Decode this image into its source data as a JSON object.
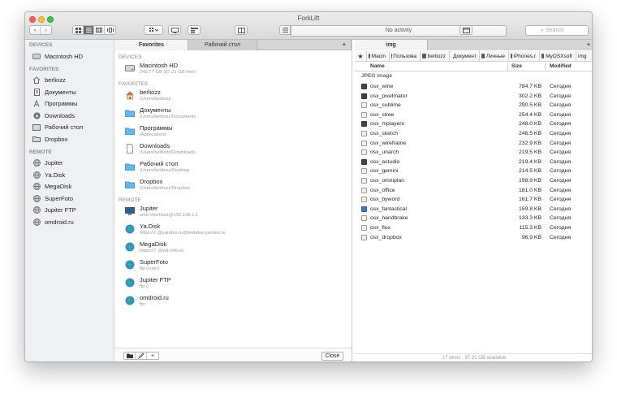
{
  "window": {
    "title": "ForkLift"
  },
  "toolbar": {
    "back": "‹",
    "forward": "›",
    "activity": "No activity",
    "search_placeholder": "Search"
  },
  "sidebar": {
    "sections": [
      {
        "title": "DEVICES",
        "items": [
          {
            "label": "Macintosh HD",
            "icon": "hard-drive-icon"
          }
        ]
      },
      {
        "title": "FAVORITES",
        "items": [
          {
            "label": "berliozz",
            "icon": "home-icon"
          },
          {
            "label": "Документы",
            "icon": "documents-icon"
          },
          {
            "label": "Программы",
            "icon": "applications-icon"
          },
          {
            "label": "Downloads",
            "icon": "downloads-icon"
          },
          {
            "label": "Рабочий стол",
            "icon": "desktop-icon"
          },
          {
            "label": "Dropbox",
            "icon": "dropbox-icon"
          }
        ]
      },
      {
        "title": "REMOTE",
        "items": [
          {
            "label": "Jupiter",
            "icon": "globe-icon"
          },
          {
            "label": "Ya.Disk",
            "icon": "globe-icon"
          },
          {
            "label": "MegaDisk",
            "icon": "globe-icon"
          },
          {
            "label": "SuperFoto",
            "icon": "globe-icon"
          },
          {
            "label": "Jupiter FTP",
            "icon": "globe-icon"
          },
          {
            "label": "omdroid.ru",
            "icon": "globe-icon"
          }
        ]
      }
    ]
  },
  "left_panel": {
    "tabs": [
      "Favorites",
      "Рабочий стол"
    ],
    "add_tab": "+",
    "sections": [
      {
        "title": "DEVICES",
        "items": [
          {
            "name": "Macintosh HD",
            "detail": "249.77 GB (97.21 GB free)",
            "icon": "hard-drive-icon"
          }
        ]
      },
      {
        "title": "FAVORITES",
        "items": [
          {
            "name": "berliozz",
            "detail": "/Users/berliozz",
            "icon": "home-icon"
          },
          {
            "name": "Документы",
            "detail": "/Users/berliozz/Documents",
            "icon": "folder-icon"
          },
          {
            "name": "Программы",
            "detail": "/Applications",
            "icon": "folder-icon"
          },
          {
            "name": "Downloads",
            "detail": "/Users/berliozz/Downloads",
            "icon": "document-icon"
          },
          {
            "name": "Рабочий стол",
            "detail": "/Users/berliozz/Desktop",
            "icon": "folder-icon"
          },
          {
            "name": "Dropbox",
            "detail": "/Users/berliozz/Dropbox",
            "icon": "folder-icon"
          }
        ]
      },
      {
        "title": "REMOTE",
        "items": [
          {
            "name": "Jupiter",
            "detail": "smb://berliozz@192.168.1.1",
            "icon": "monitor-icon"
          },
          {
            "name": "Ya.Disk",
            "detail": "https://c                  @yandex.ru@webdav.yandex.ru",
            "icon": "globe-icon"
          },
          {
            "name": "MegaDisk",
            "detail": "https://7                  @wd.mfd.sk",
            "icon": "globe-icon"
          },
          {
            "name": "SuperFoto",
            "detail": "ftp://user(",
            "icon": "globe-icon"
          },
          {
            "name": "Jupiter FTP",
            "detail": "ftp://",
            "icon": "globe-icon"
          },
          {
            "name": "omdroid.ru",
            "detail": "ftp",
            "icon": "globe-icon"
          }
        ]
      }
    ],
    "close_label": "Close"
  },
  "right_panel": {
    "tab": "img",
    "add_tab": "+",
    "breadcrumb": [
      "Macin",
      "Пользова",
      "berliozz",
      "Документ",
      "Личные",
      "iPhones,r",
      "MyOSXsoft",
      "img"
    ],
    "columns": {
      "name": "Name",
      "size": "Size",
      "modified": "Modified"
    },
    "group": "JPEG image",
    "files": [
      {
        "name": "osx_wine",
        "size": "784.7 KB",
        "modified": "Сегодня",
        "icon": "image-file-icon"
      },
      {
        "name": "osx_pixelmator",
        "size": "302.2 KB",
        "modified": "Сегодня",
        "icon": "image-file-icon"
      },
      {
        "name": "osx_sublime",
        "size": "290.5 KB",
        "modified": "Сегодня",
        "icon": "image-file-icon"
      },
      {
        "name": "osx_stree",
        "size": "254.4 KB",
        "modified": "Сегодня",
        "icon": "image-file-icon"
      },
      {
        "name": "osx_mplayerx",
        "size": "248.0 KB",
        "modified": "Сегодня",
        "icon": "image-file-icon"
      },
      {
        "name": "osx_sketch",
        "size": "246.5 KB",
        "modified": "Сегодня",
        "icon": "image-file-icon"
      },
      {
        "name": "osx_wireframe",
        "size": "232.9 KB",
        "modified": "Сегодня",
        "icon": "image-file-icon"
      },
      {
        "name": "osx_unarch",
        "size": "219.5 KB",
        "modified": "Сегодня",
        "icon": "image-file-icon"
      },
      {
        "name": "osx_astudio",
        "size": "219.4 KB",
        "modified": "Сегодня",
        "icon": "image-file-icon"
      },
      {
        "name": "osx_gemini",
        "size": "214.5 KB",
        "modified": "Сегодня",
        "icon": "image-file-icon"
      },
      {
        "name": "osx_omniplan",
        "size": "198.9 KB",
        "modified": "Сегодня",
        "icon": "image-file-icon"
      },
      {
        "name": "osx_office",
        "size": "181.0 KB",
        "modified": "Сегодня",
        "icon": "image-file-icon"
      },
      {
        "name": "osx_byword",
        "size": "161.7 KB",
        "modified": "Сегодня",
        "icon": "image-file-icon"
      },
      {
        "name": "osx_fantastical",
        "size": "159.8 KB",
        "modified": "Сегодня",
        "icon": "image-file-icon"
      },
      {
        "name": "osx_handbrake",
        "size": "133.3 KB",
        "modified": "Сегодня",
        "icon": "image-file-icon"
      },
      {
        "name": "osx_flux",
        "size": "115.3 KB",
        "modified": "Сегодня",
        "icon": "image-file-icon"
      },
      {
        "name": "osx_dropbox",
        "size": "96.9 KB",
        "modified": "Сегодня",
        "icon": "image-file-icon"
      }
    ],
    "status": "17 items , 97.21 GB available"
  }
}
